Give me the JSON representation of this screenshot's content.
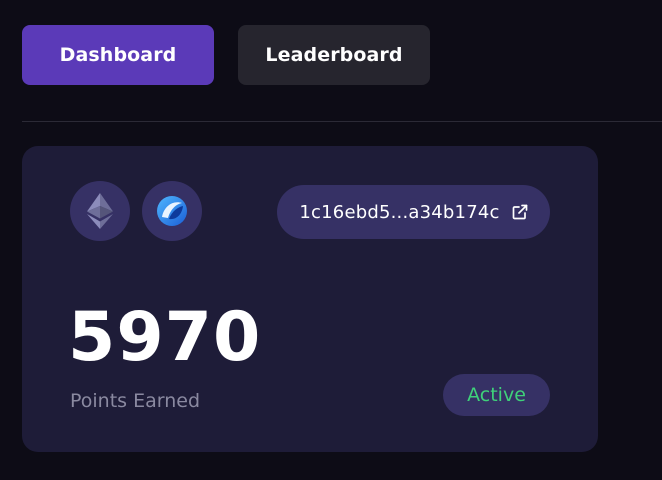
{
  "nav": {
    "tabs": [
      {
        "label": "Dashboard",
        "active": true
      },
      {
        "label": "Leaderboard",
        "active": false
      }
    ]
  },
  "card": {
    "chains": [
      {
        "icon": "ethereum-icon"
      },
      {
        "icon": "blue-swirl-chain-icon"
      }
    ],
    "address": "1c16ebd5...a34b174c",
    "address_icon": "external-link-icon",
    "points": "5970",
    "points_label": "Points Earned",
    "status": "Active"
  },
  "colors": {
    "background": "#0d0c16",
    "card": "#1e1c38",
    "accent": "#5b3ab8",
    "pill": "#363165",
    "status": "#3fd17a",
    "muted_text": "#8a89a0"
  }
}
